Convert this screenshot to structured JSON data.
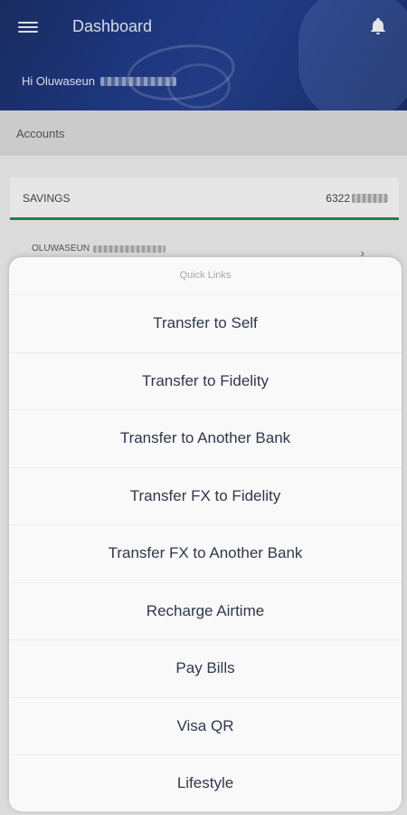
{
  "header": {
    "title": "Dashboard",
    "greeting": "Hi Oluwaseun",
    "icons": {
      "menu": "hamburger-menu-icon",
      "notifications": "bell-icon"
    }
  },
  "accounts": {
    "section_label": "Accounts",
    "account_type": "SAVINGS",
    "account_number_prefix": "6322",
    "account_name_prefix": "OLUWASEUN",
    "accent_color": "#1f8a52"
  },
  "quick_links": {
    "title": "Quick Links",
    "items": [
      "Transfer to Self",
      "Transfer to Fidelity",
      "Transfer to Another Bank",
      "Transfer FX to Fidelity",
      "Transfer FX to Another Bank",
      "Recharge Airtime",
      "Pay Bills",
      "Visa QR",
      "Lifestyle"
    ]
  }
}
